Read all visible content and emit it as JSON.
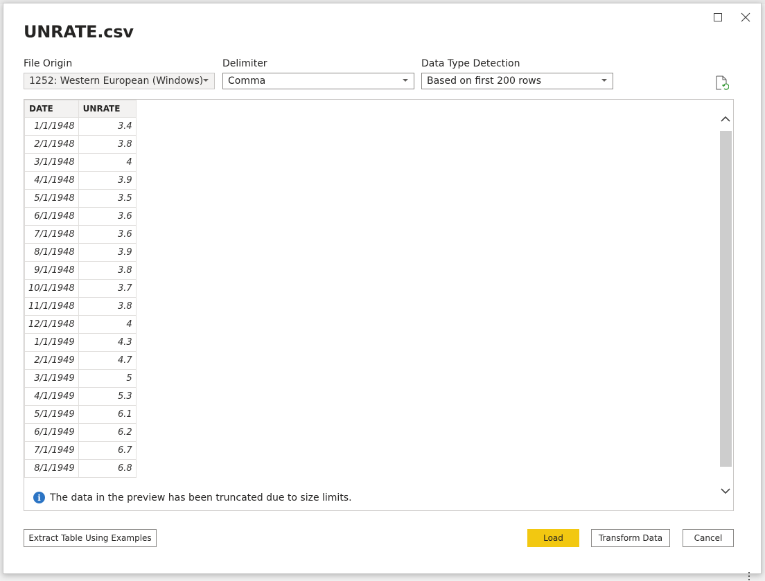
{
  "dialog": {
    "title": "UNRATE.csv",
    "file_origin": {
      "label": "File Origin",
      "value": "1252: Western European (Windows)"
    },
    "delimiter": {
      "label": "Delimiter",
      "value": "Comma"
    },
    "detection": {
      "label": "Data Type Detection",
      "value": "Based on first 200 rows"
    }
  },
  "table": {
    "columns": [
      "DATE",
      "UNRATE"
    ],
    "rows": [
      [
        "1/1/1948",
        "3.4"
      ],
      [
        "2/1/1948",
        "3.8"
      ],
      [
        "3/1/1948",
        "4"
      ],
      [
        "4/1/1948",
        "3.9"
      ],
      [
        "5/1/1948",
        "3.5"
      ],
      [
        "6/1/1948",
        "3.6"
      ],
      [
        "7/1/1948",
        "3.6"
      ],
      [
        "8/1/1948",
        "3.9"
      ],
      [
        "9/1/1948",
        "3.8"
      ],
      [
        "10/1/1948",
        "3.7"
      ],
      [
        "11/1/1948",
        "3.8"
      ],
      [
        "12/1/1948",
        "4"
      ],
      [
        "1/1/1949",
        "4.3"
      ],
      [
        "2/1/1949",
        "4.7"
      ],
      [
        "3/1/1949",
        "5"
      ],
      [
        "4/1/1949",
        "5.3"
      ],
      [
        "5/1/1949",
        "6.1"
      ],
      [
        "6/1/1949",
        "6.2"
      ],
      [
        "7/1/1949",
        "6.7"
      ],
      [
        "8/1/1949",
        "6.8"
      ]
    ]
  },
  "notice": "The data in the preview has been truncated due to size limits.",
  "buttons": {
    "extract": "Extract Table Using Examples",
    "load": "Load",
    "transform": "Transform Data",
    "cancel": "Cancel"
  },
  "colors": {
    "primary": "#f2c811",
    "info": "#2b74c4"
  }
}
